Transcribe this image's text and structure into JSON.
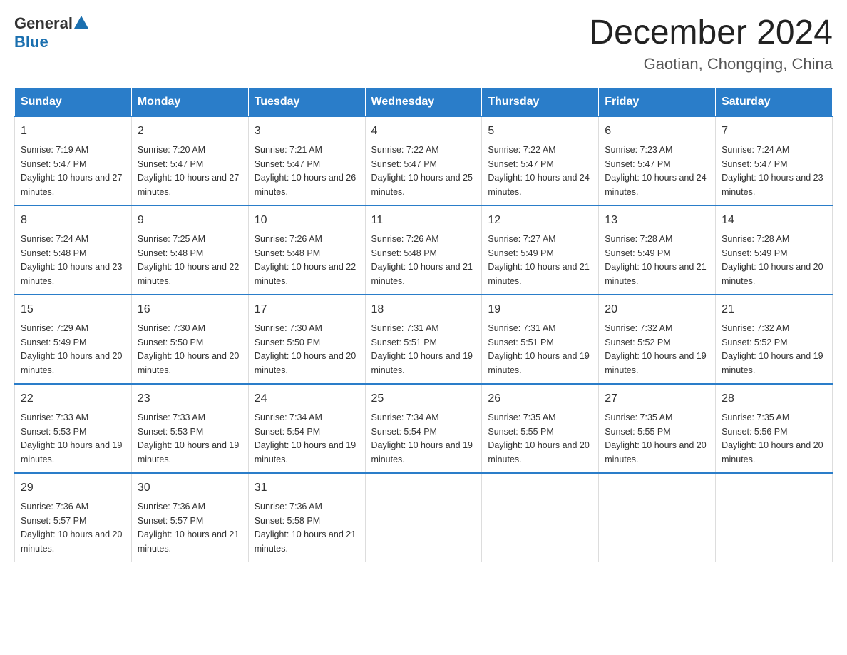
{
  "header": {
    "logo_general": "General",
    "logo_blue": "Blue",
    "month_title": "December 2024",
    "location": "Gaotian, Chongqing, China"
  },
  "days_of_week": [
    "Sunday",
    "Monday",
    "Tuesday",
    "Wednesday",
    "Thursday",
    "Friday",
    "Saturday"
  ],
  "weeks": [
    [
      {
        "day": "1",
        "sunrise": "7:19 AM",
        "sunset": "5:47 PM",
        "daylight": "10 hours and 27 minutes."
      },
      {
        "day": "2",
        "sunrise": "7:20 AM",
        "sunset": "5:47 PM",
        "daylight": "10 hours and 27 minutes."
      },
      {
        "day": "3",
        "sunrise": "7:21 AM",
        "sunset": "5:47 PM",
        "daylight": "10 hours and 26 minutes."
      },
      {
        "day": "4",
        "sunrise": "7:22 AM",
        "sunset": "5:47 PM",
        "daylight": "10 hours and 25 minutes."
      },
      {
        "day": "5",
        "sunrise": "7:22 AM",
        "sunset": "5:47 PM",
        "daylight": "10 hours and 24 minutes."
      },
      {
        "day": "6",
        "sunrise": "7:23 AM",
        "sunset": "5:47 PM",
        "daylight": "10 hours and 24 minutes."
      },
      {
        "day": "7",
        "sunrise": "7:24 AM",
        "sunset": "5:47 PM",
        "daylight": "10 hours and 23 minutes."
      }
    ],
    [
      {
        "day": "8",
        "sunrise": "7:24 AM",
        "sunset": "5:48 PM",
        "daylight": "10 hours and 23 minutes."
      },
      {
        "day": "9",
        "sunrise": "7:25 AM",
        "sunset": "5:48 PM",
        "daylight": "10 hours and 22 minutes."
      },
      {
        "day": "10",
        "sunrise": "7:26 AM",
        "sunset": "5:48 PM",
        "daylight": "10 hours and 22 minutes."
      },
      {
        "day": "11",
        "sunrise": "7:26 AM",
        "sunset": "5:48 PM",
        "daylight": "10 hours and 21 minutes."
      },
      {
        "day": "12",
        "sunrise": "7:27 AM",
        "sunset": "5:49 PM",
        "daylight": "10 hours and 21 minutes."
      },
      {
        "day": "13",
        "sunrise": "7:28 AM",
        "sunset": "5:49 PM",
        "daylight": "10 hours and 21 minutes."
      },
      {
        "day": "14",
        "sunrise": "7:28 AM",
        "sunset": "5:49 PM",
        "daylight": "10 hours and 20 minutes."
      }
    ],
    [
      {
        "day": "15",
        "sunrise": "7:29 AM",
        "sunset": "5:49 PM",
        "daylight": "10 hours and 20 minutes."
      },
      {
        "day": "16",
        "sunrise": "7:30 AM",
        "sunset": "5:50 PM",
        "daylight": "10 hours and 20 minutes."
      },
      {
        "day": "17",
        "sunrise": "7:30 AM",
        "sunset": "5:50 PM",
        "daylight": "10 hours and 20 minutes."
      },
      {
        "day": "18",
        "sunrise": "7:31 AM",
        "sunset": "5:51 PM",
        "daylight": "10 hours and 19 minutes."
      },
      {
        "day": "19",
        "sunrise": "7:31 AM",
        "sunset": "5:51 PM",
        "daylight": "10 hours and 19 minutes."
      },
      {
        "day": "20",
        "sunrise": "7:32 AM",
        "sunset": "5:52 PM",
        "daylight": "10 hours and 19 minutes."
      },
      {
        "day": "21",
        "sunrise": "7:32 AM",
        "sunset": "5:52 PM",
        "daylight": "10 hours and 19 minutes."
      }
    ],
    [
      {
        "day": "22",
        "sunrise": "7:33 AM",
        "sunset": "5:53 PM",
        "daylight": "10 hours and 19 minutes."
      },
      {
        "day": "23",
        "sunrise": "7:33 AM",
        "sunset": "5:53 PM",
        "daylight": "10 hours and 19 minutes."
      },
      {
        "day": "24",
        "sunrise": "7:34 AM",
        "sunset": "5:54 PM",
        "daylight": "10 hours and 19 minutes."
      },
      {
        "day": "25",
        "sunrise": "7:34 AM",
        "sunset": "5:54 PM",
        "daylight": "10 hours and 19 minutes."
      },
      {
        "day": "26",
        "sunrise": "7:35 AM",
        "sunset": "5:55 PM",
        "daylight": "10 hours and 20 minutes."
      },
      {
        "day": "27",
        "sunrise": "7:35 AM",
        "sunset": "5:55 PM",
        "daylight": "10 hours and 20 minutes."
      },
      {
        "day": "28",
        "sunrise": "7:35 AM",
        "sunset": "5:56 PM",
        "daylight": "10 hours and 20 minutes."
      }
    ],
    [
      {
        "day": "29",
        "sunrise": "7:36 AM",
        "sunset": "5:57 PM",
        "daylight": "10 hours and 20 minutes."
      },
      {
        "day": "30",
        "sunrise": "7:36 AM",
        "sunset": "5:57 PM",
        "daylight": "10 hours and 21 minutes."
      },
      {
        "day": "31",
        "sunrise": "7:36 AM",
        "sunset": "5:58 PM",
        "daylight": "10 hours and 21 minutes."
      },
      null,
      null,
      null,
      null
    ]
  ],
  "labels": {
    "sunrise": "Sunrise:",
    "sunset": "Sunset:",
    "daylight": "Daylight:"
  }
}
